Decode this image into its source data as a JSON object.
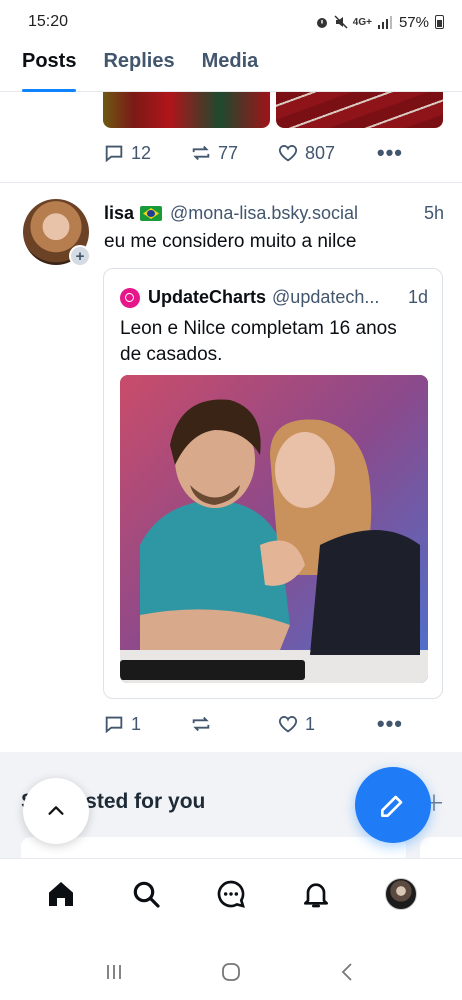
{
  "status_bar": {
    "time": "15:20",
    "icons": [
      "alarm-icon",
      "mute-icon",
      "4g-icon",
      "signal-icon"
    ],
    "network": "4G+",
    "battery": "57%"
  },
  "tabs": [
    {
      "label": "Posts",
      "active": true
    },
    {
      "label": "Replies",
      "active": false
    },
    {
      "label": "Media",
      "active": false
    }
  ],
  "previous_post": {
    "replies": "12",
    "reposts": "77",
    "likes": "807"
  },
  "post": {
    "author": "lisa",
    "flag": "Brazil",
    "handle": "@mona-lisa.bsky.social",
    "time": "5h",
    "text": "eu me considero muito a nilce",
    "quote": {
      "author": "UpdateCharts",
      "handle": "@updatech...",
      "time": "1d",
      "text": "Leon e Nilce completam 16 anos de casados."
    },
    "replies": "1",
    "reposts": "",
    "likes": "1"
  },
  "suggested": {
    "title": "Suggested for you"
  },
  "colors": {
    "accent": "#1083fe",
    "muted": "#42566e",
    "compose_fab": "#1f7cf6"
  },
  "bottom_nav": [
    "home-icon",
    "search-icon",
    "chat-icon",
    "notifications-icon",
    "profile-avatar"
  ]
}
